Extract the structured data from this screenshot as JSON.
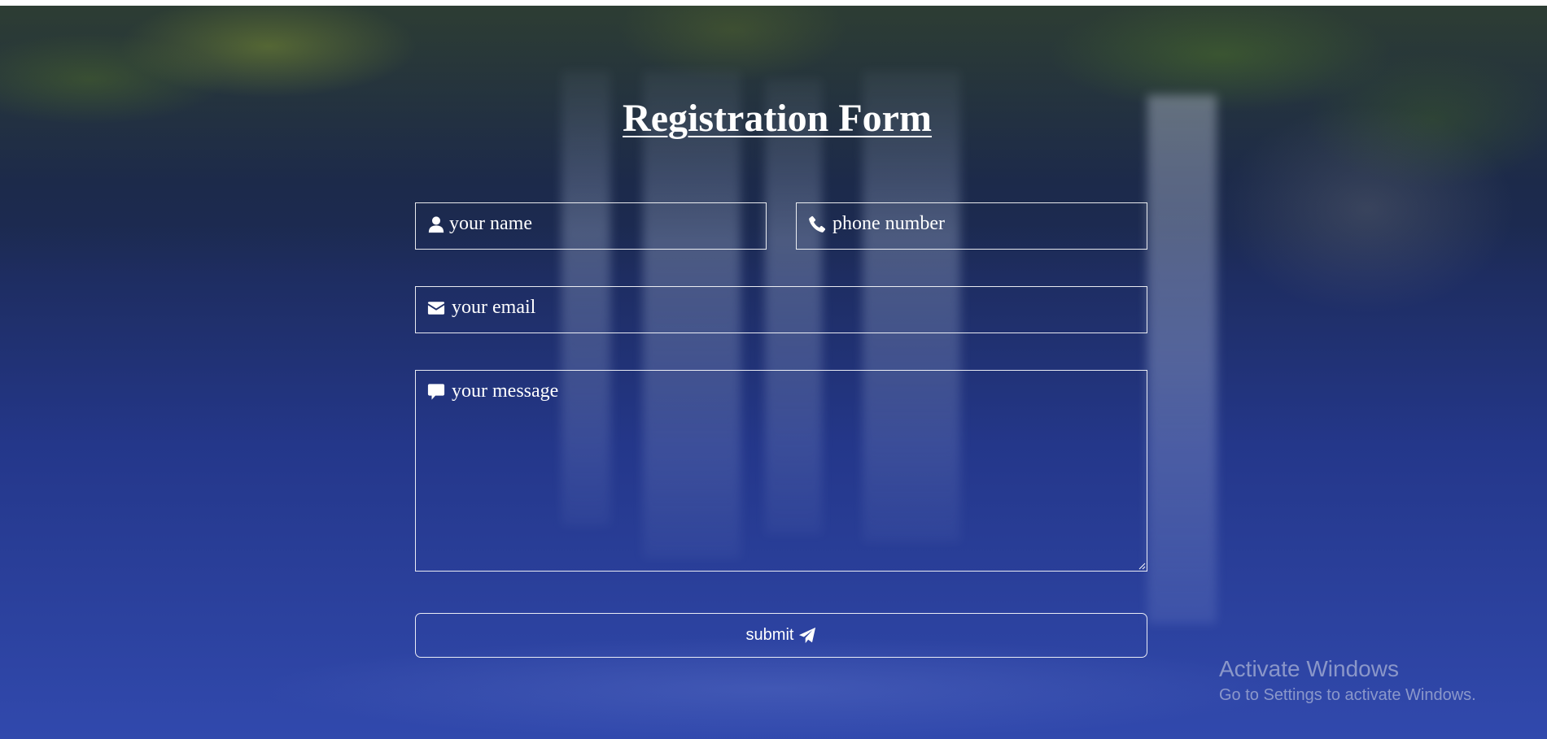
{
  "page": {
    "title": "Registration Form"
  },
  "form": {
    "name_placeholder": "your name",
    "phone_placeholder": "phone number",
    "email_placeholder": "your email",
    "message_placeholder": "your message",
    "submit_label": "submit"
  },
  "icons": {
    "name": "user-icon",
    "phone": "phone-icon",
    "email": "envelope-icon",
    "message": "comment-icon",
    "submit": "paper-plane-icon"
  },
  "watermark": {
    "title": "Activate Windows",
    "subtitle": "Go to Settings to activate Windows."
  },
  "colors": {
    "background_top": "#1b2647",
    "background_bottom": "#3149ad",
    "text": "#ffffff",
    "field_border": "#ffffff"
  }
}
